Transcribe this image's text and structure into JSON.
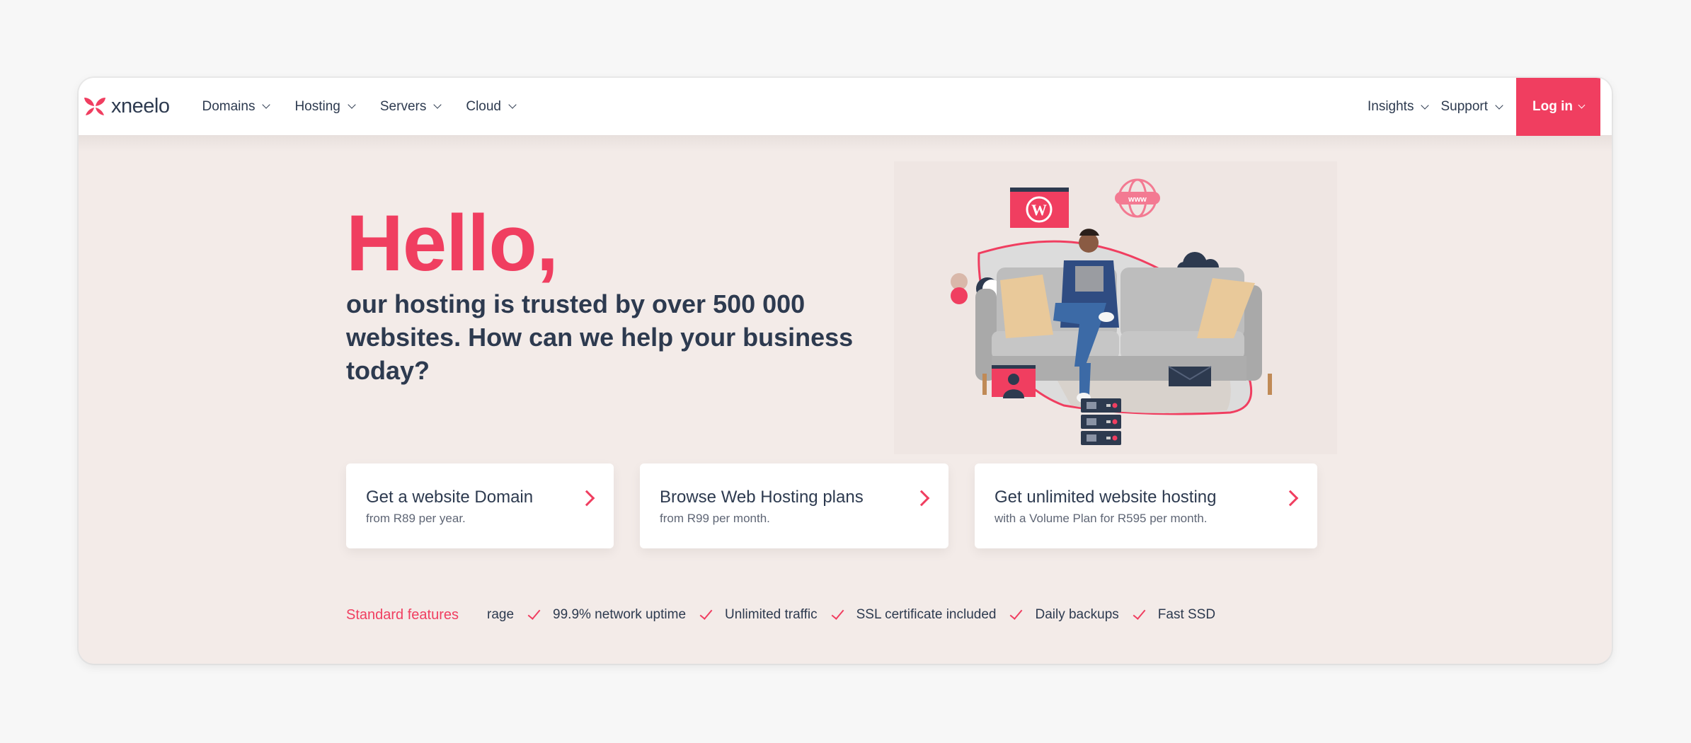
{
  "brand": {
    "name": "xneelo",
    "accent_color": "#f03e60",
    "text_color": "#2d3a4f"
  },
  "nav": {
    "left_items": [
      {
        "label": "Domains"
      },
      {
        "label": "Hosting"
      },
      {
        "label": "Servers"
      },
      {
        "label": "Cloud"
      }
    ],
    "right_items": [
      {
        "label": "Insights"
      },
      {
        "label": "Support"
      }
    ],
    "login_label": "Log in"
  },
  "hero": {
    "title": "Hello,",
    "subtitle": "our hosting is trusted by over 500 000 websites. How can we help your business today?",
    "illustration": {
      "description": "Man on grey sofa with laptop surrounded by hosting icons",
      "icons": [
        "wordpress-icon",
        "globe-www-icon",
        "cloud-icon",
        "user-profile-icon",
        "email-icon",
        "server-stack-icon",
        "toggle-icon"
      ]
    }
  },
  "cards": [
    {
      "title": "Get a website Domain",
      "subtitle": "from R89 per year."
    },
    {
      "title": "Browse Web Hosting plans",
      "subtitle": "from R99 per month."
    },
    {
      "title": "Get unlimited website hosting",
      "subtitle": "with a Volume Plan for R595 per month."
    }
  ],
  "features": {
    "label": "Standard features",
    "partial_first": "rage",
    "items": [
      "99.9% network uptime",
      "Unlimited traffic",
      "SSL certificate included",
      "Daily backups",
      "Fast SSD"
    ]
  }
}
